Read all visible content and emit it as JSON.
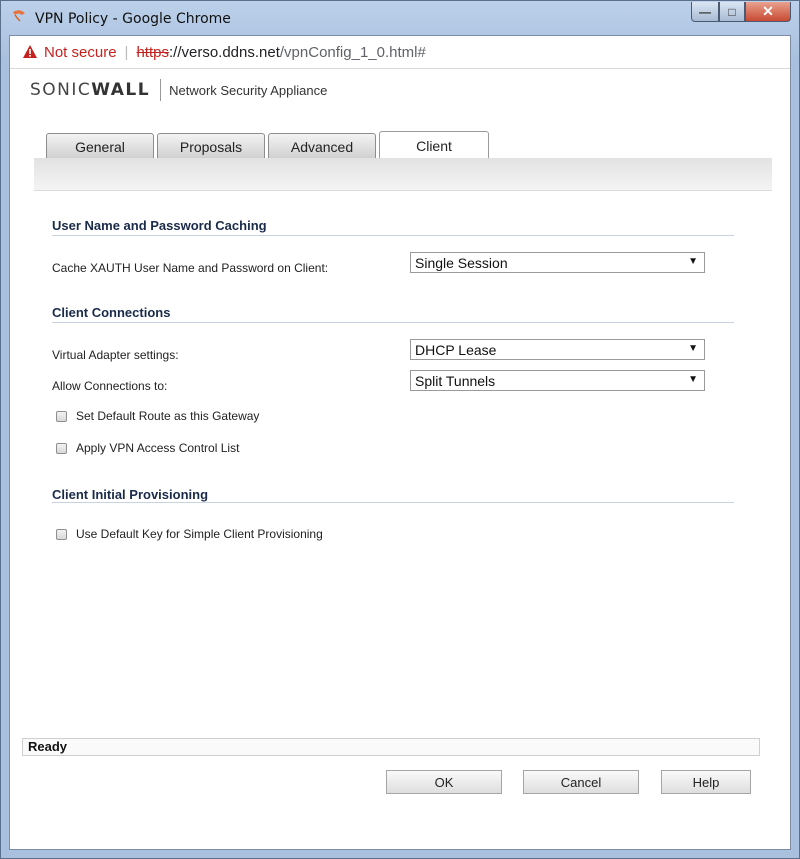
{
  "window": {
    "title": "VPN Policy - Google Chrome",
    "controls": {
      "minimize": "—",
      "maximize": "□",
      "close": "✕"
    }
  },
  "address": {
    "warning_text": "Not secure",
    "url_scheme": "https",
    "url_host": "://verso.ddns.net",
    "url_path": "/vpnConfig_1_0.html#"
  },
  "brand": {
    "logo_part1": "SONIC",
    "logo_part2": "WALL",
    "subtitle": "Network Security Appliance"
  },
  "tabs": [
    {
      "label": "General",
      "active": false
    },
    {
      "label": "Proposals",
      "active": false
    },
    {
      "label": "Advanced",
      "active": false
    },
    {
      "label": "Client",
      "active": true
    }
  ],
  "sections": {
    "caching": {
      "title": "User Name and Password Caching",
      "cache_label": "Cache XAUTH User Name and Password on Client:",
      "cache_value": "Single Session"
    },
    "connections": {
      "title": "Client Connections",
      "adapter_label": "Virtual Adapter settings:",
      "adapter_value": "DHCP Lease",
      "allow_label": "Allow Connections to:",
      "allow_value": "Split Tunnels",
      "default_route_label": "Set Default Route as this Gateway",
      "default_route_checked": false,
      "acl_label": "Apply VPN Access Control List",
      "acl_checked": false
    },
    "provisioning": {
      "title": "Client Initial Provisioning",
      "default_key_label": "Use Default Key for Simple Client Provisioning",
      "default_key_checked": false
    }
  },
  "status": "Ready",
  "buttons": {
    "ok": "OK",
    "cancel": "Cancel",
    "help": "Help"
  },
  "icons": {
    "window_icon": "chrome-page-icon",
    "warning_icon": "warning-triangle-icon",
    "dropdown_icon": "chevron-down-icon"
  },
  "colors": {
    "not_secure": "#c5221f",
    "section_title": "#1a2b4a",
    "close_button": "#c84a32"
  }
}
